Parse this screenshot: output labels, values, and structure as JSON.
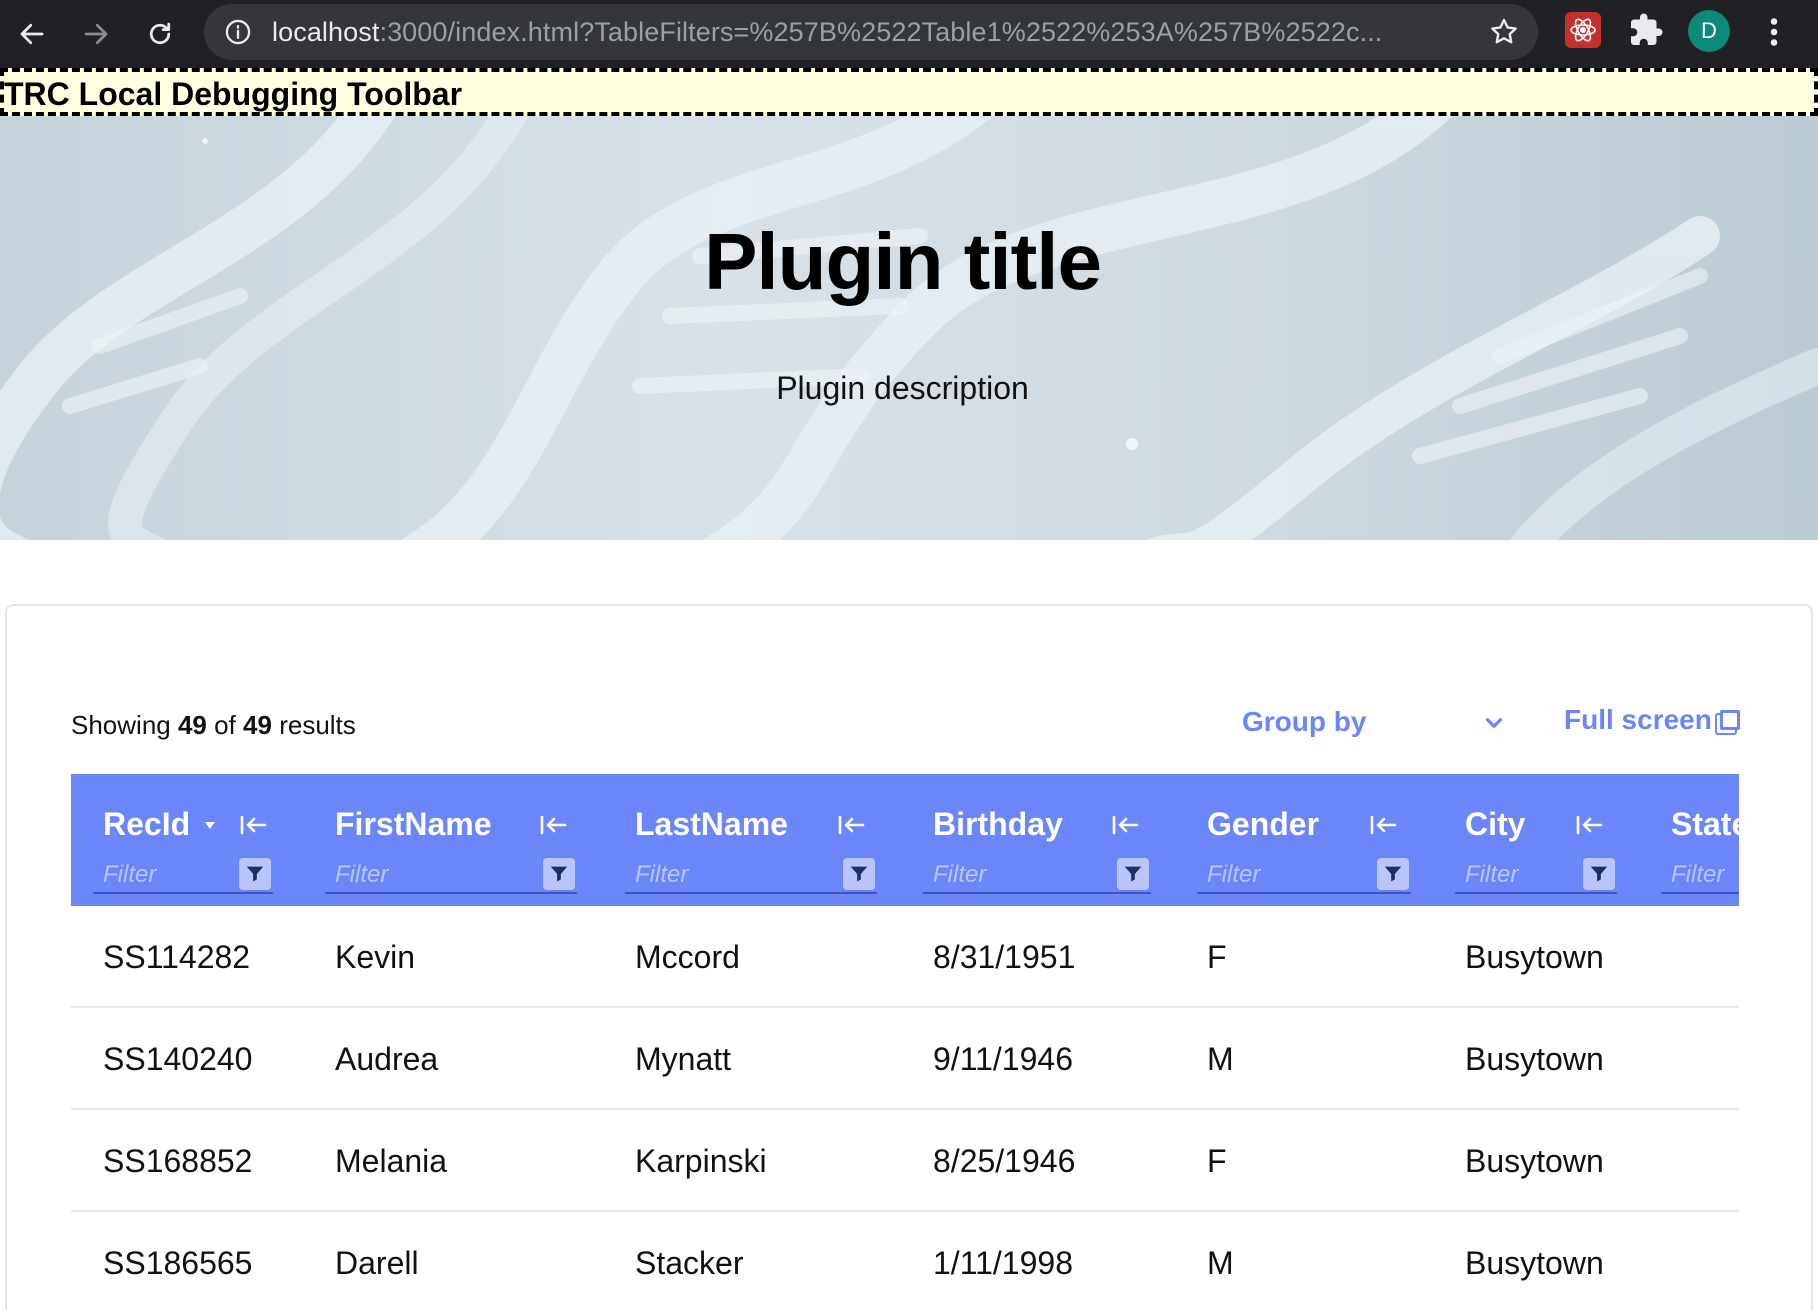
{
  "browser": {
    "url_host": "localhost",
    "url_rest": ":3000/index.html?TableFilters=%257B%2522Table1%2522%253A%257B%2522c...",
    "profile_initial": "D"
  },
  "debug_toolbar": {
    "label": "TRC Local Debugging Toolbar"
  },
  "hero": {
    "title": "Plugin title",
    "description": "Plugin description"
  },
  "results": {
    "prefix": "Showing",
    "shown": "49",
    "middle": "of",
    "total": "49",
    "suffix": "results"
  },
  "controls": {
    "group_by_label": "Group by",
    "full_screen_label": "Full screen"
  },
  "table": {
    "filter_placeholder": "Filter",
    "columns": [
      {
        "label": "RecId",
        "sorted": "descending"
      },
      {
        "label": "FirstName"
      },
      {
        "label": "LastName"
      },
      {
        "label": "Birthday"
      },
      {
        "label": "Gender"
      },
      {
        "label": "City"
      },
      {
        "label": "State"
      }
    ],
    "rows": [
      [
        "SS114282",
        "Kevin",
        "Mccord",
        "8/31/1951",
        "F",
        "Busytown"
      ],
      [
        "SS140240",
        "Audrea",
        "Mynatt",
        "9/11/1946",
        "M",
        "Busytown"
      ],
      [
        "SS168852",
        "Melania",
        "Karpinski",
        "8/25/1946",
        "F",
        "Busytown"
      ],
      [
        "SS186565",
        "Darell",
        "Stacker",
        "1/11/1998",
        "M",
        "Busytown"
      ]
    ]
  },
  "colors": {
    "accent": "#6a86f8",
    "chrome": "#202124",
    "debug_bar": "#ffffe0"
  }
}
